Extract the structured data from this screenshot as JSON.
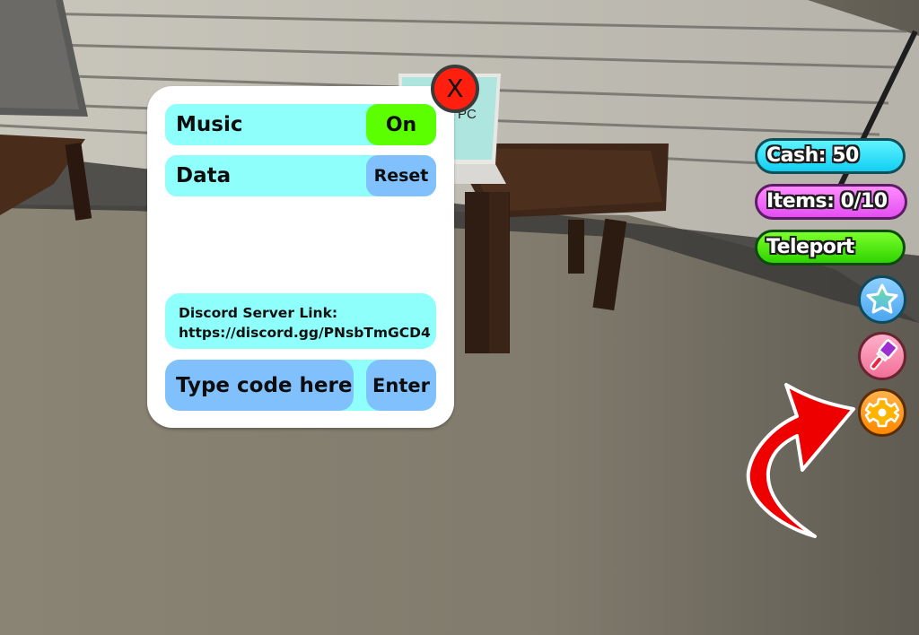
{
  "settings_panel": {
    "music": {
      "label": "Music",
      "toggle_label": "On",
      "state": "on"
    },
    "data": {
      "label": "Data",
      "button_label": "Reset"
    },
    "discord": {
      "line1": "Discord Server Link:",
      "line2": "https://discord.gg/PNsbTmGCD4"
    },
    "code": {
      "placeholder": "Type code here",
      "value": "",
      "enter_label": "Enter"
    },
    "close_label": "X"
  },
  "hud": {
    "cash_label": "Cash: 50",
    "items_label": "Items: 0/10",
    "teleport_label": "Teleport",
    "icon_buttons": [
      {
        "name": "star-icon"
      },
      {
        "name": "paintbrush-icon"
      },
      {
        "name": "gear-icon"
      }
    ]
  },
  "scene": {
    "laptop_screen_text": "PC"
  },
  "colors": {
    "panel_bg": "#ffffff",
    "row_bg": "#8ffffb",
    "toggle_on": "#5cff00",
    "button_blue": "#80c1fd",
    "close_red": "#ff1f0f",
    "cash": "#12cff2",
    "items": "#e24ff0",
    "teleport": "#2ed400",
    "arrow_red": "#ee0000"
  }
}
